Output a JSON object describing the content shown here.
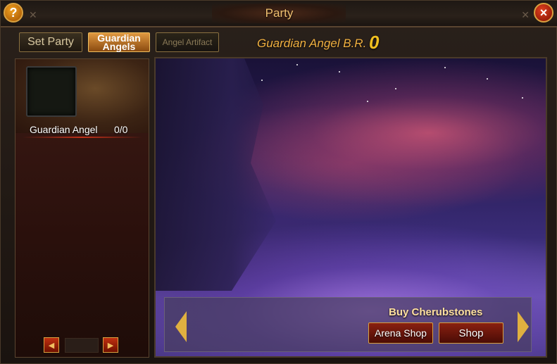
{
  "window": {
    "title": "Party",
    "help_label": "?",
    "close_label": "×"
  },
  "tabs": [
    {
      "label": "Set Party",
      "state": "normal"
    },
    {
      "label": "Guardian Angels",
      "state": "active"
    },
    {
      "label": "Angel Artifact",
      "state": "disabled"
    }
  ],
  "battle_rating": {
    "label": "Guardian Angel B.R.",
    "value": "0"
  },
  "angel_list": {
    "items": [
      {
        "name": "Guardian Angel",
        "count": "0/0"
      }
    ],
    "pager": {
      "prev_icon": "arrow-left-icon",
      "next_icon": "arrow-right-icon",
      "prev_glyph": "◀",
      "next_glyph": "▶"
    }
  },
  "shop": {
    "heading": "Buy Cherubstones",
    "arena_shop_label": "Arena Shop",
    "shop_label": "Shop"
  },
  "colors": {
    "accent_gold": "#f0b040",
    "active_tab": "#e09840",
    "button_red": "#8a2010"
  }
}
